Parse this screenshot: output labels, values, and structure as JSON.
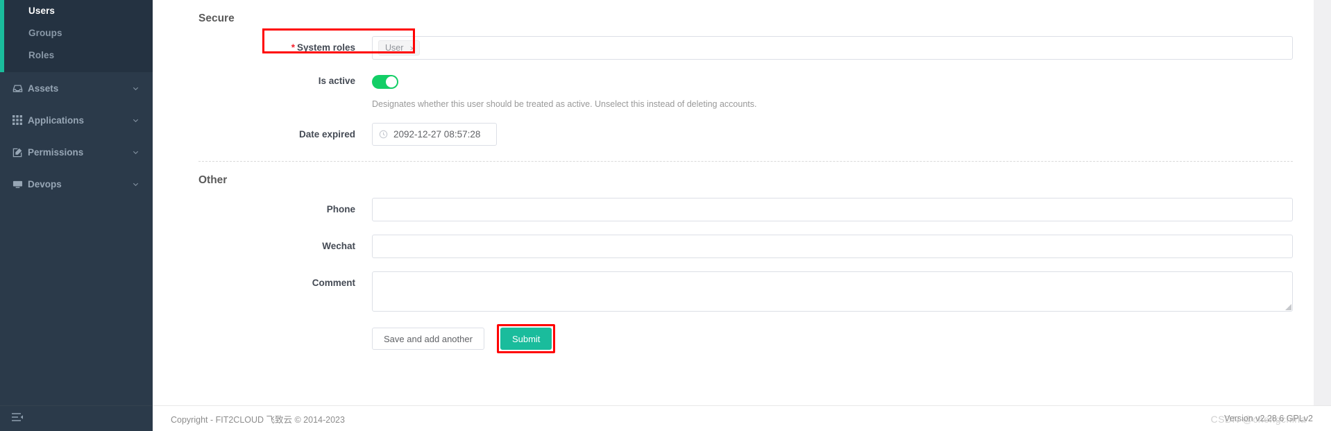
{
  "theme": {
    "accent": "#1abc9c",
    "sidebar_bg": "#2b3a4a",
    "sidebar_sub_bg": "#243241",
    "highlight": "#ff0000",
    "required_star": "#f5222d",
    "switch_on": "#13ce66"
  },
  "sidebar": {
    "sub_items": [
      {
        "label": "Users",
        "name": "sidebar-item-users",
        "active": true
      },
      {
        "label": "Groups",
        "name": "sidebar-item-groups",
        "active": false
      },
      {
        "label": "Roles",
        "name": "sidebar-item-roles",
        "active": false
      }
    ],
    "nav_items": [
      {
        "label": "Assets",
        "icon": "inbox-icon",
        "chevron": "chevron-down-icon"
      },
      {
        "label": "Applications",
        "icon": "grid-icon",
        "chevron": "chevron-down-icon"
      },
      {
        "label": "Permissions",
        "icon": "edit-square-icon",
        "chevron": "chevron-down-icon"
      },
      {
        "label": "Devops",
        "icon": "monitor-icon",
        "chevron": "chevron-down-icon"
      }
    ],
    "collapse_icon": "menu-collapse-icon"
  },
  "form": {
    "sections": [
      {
        "title": "Secure"
      },
      {
        "title": "Other"
      }
    ],
    "system_roles": {
      "label": "System roles",
      "required": true,
      "required_mark": "*",
      "tags": [
        {
          "text": "User",
          "remove": "×"
        }
      ]
    },
    "is_active": {
      "label": "Is active",
      "value": true,
      "help": "Designates whether this user should be treated as active. Unselect this instead of deleting accounts."
    },
    "date_expired": {
      "label": "Date expired",
      "value": "2092-12-27 08:57:28",
      "icon": "clock-icon"
    },
    "phone": {
      "label": "Phone",
      "value": "",
      "placeholder": ""
    },
    "wechat": {
      "label": "Wechat",
      "value": "",
      "placeholder": ""
    },
    "comment": {
      "label": "Comment",
      "value": "",
      "placeholder": ""
    }
  },
  "actions": {
    "save_and_add_another": "Save and add another",
    "submit": "Submit"
  },
  "footer": {
    "copyright": "Copyright - FIT2CLOUD 飞致云 © 2014-2023",
    "version": "Version v2.28.6 GPLv2",
    "watermark": "CSDN @chengchina"
  }
}
